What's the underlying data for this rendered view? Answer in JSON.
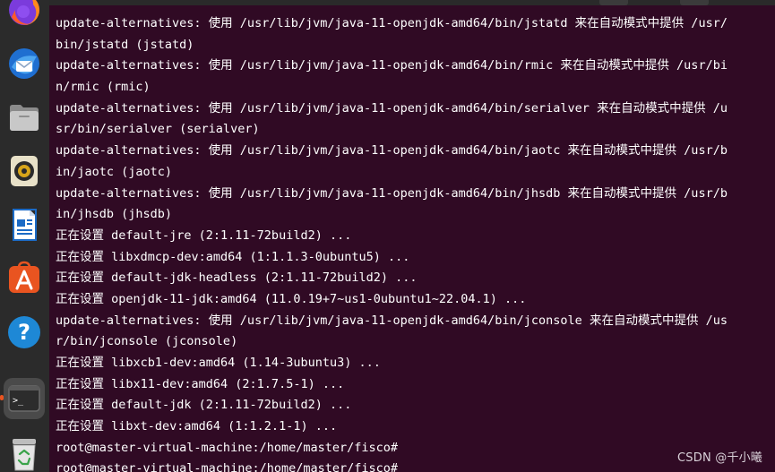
{
  "dock": {
    "items": [
      {
        "name": "Firefox",
        "icon": "firefox-icon"
      },
      {
        "name": "Thunderbird",
        "icon": "thunderbird-icon"
      },
      {
        "name": "Files",
        "icon": "files-icon"
      },
      {
        "name": "Rhythmbox",
        "icon": "rhythmbox-icon"
      },
      {
        "name": "LibreOffice Writer",
        "icon": "writer-icon"
      },
      {
        "name": "Ubuntu Software",
        "icon": "software-store-icon"
      },
      {
        "name": "Help",
        "icon": "help-icon"
      },
      {
        "name": "Terminal",
        "icon": "terminal-icon",
        "active": true
      },
      {
        "name": "Trash",
        "icon": "trash-icon"
      }
    ],
    "terminal_glyph": ">_",
    "help_glyph": "?"
  },
  "terminal": {
    "background": "#300a24",
    "foreground": "#ffffff",
    "lines": [
      "update-alternatives: 使用 /usr/lib/jvm/java-11-openjdk-amd64/bin/jstatd 来在自动模式中提供 /usr/",
      "bin/jstatd (jstatd)",
      "update-alternatives: 使用 /usr/lib/jvm/java-11-openjdk-amd64/bin/rmic 来在自动模式中提供 /usr/bi",
      "n/rmic (rmic)",
      "update-alternatives: 使用 /usr/lib/jvm/java-11-openjdk-amd64/bin/serialver 来在自动模式中提供 /u",
      "sr/bin/serialver (serialver)",
      "update-alternatives: 使用 /usr/lib/jvm/java-11-openjdk-amd64/bin/jaotc 来在自动模式中提供 /usr/b",
      "in/jaotc (jaotc)",
      "update-alternatives: 使用 /usr/lib/jvm/java-11-openjdk-amd64/bin/jhsdb 来在自动模式中提供 /usr/b",
      "in/jhsdb (jhsdb)",
      "正在设置 default-jre (2:1.11-72build2) ...",
      "正在设置 libxdmcp-dev:amd64 (1:1.1.3-0ubuntu5) ...",
      "正在设置 default-jdk-headless (2:1.11-72build2) ...",
      "正在设置 openjdk-11-jdk:amd64 (11.0.19+7~us1-0ubuntu1~22.04.1) ...",
      "update-alternatives: 使用 /usr/lib/jvm/java-11-openjdk-amd64/bin/jconsole 来在自动模式中提供 /us",
      "r/bin/jconsole (jconsole)",
      "正在设置 libxcb1-dev:amd64 (1.14-3ubuntu3) ...",
      "正在设置 libx11-dev:amd64 (2:1.7.5-1) ...",
      "正在设置 default-jdk (2:1.11-72build2) ...",
      "正在设置 libxt-dev:amd64 (1:1.2.1-1) ...",
      "root@master-virtual-machine:/home/master/fisco#",
      "root@master-virtual-machine:/home/master/fisco#"
    ]
  },
  "watermark": "CSDN @千小曦",
  "colors": {
    "dock_bg": "#2b2b2b",
    "active_indicator": "#e95420",
    "terminal_bg": "#300a24"
  }
}
